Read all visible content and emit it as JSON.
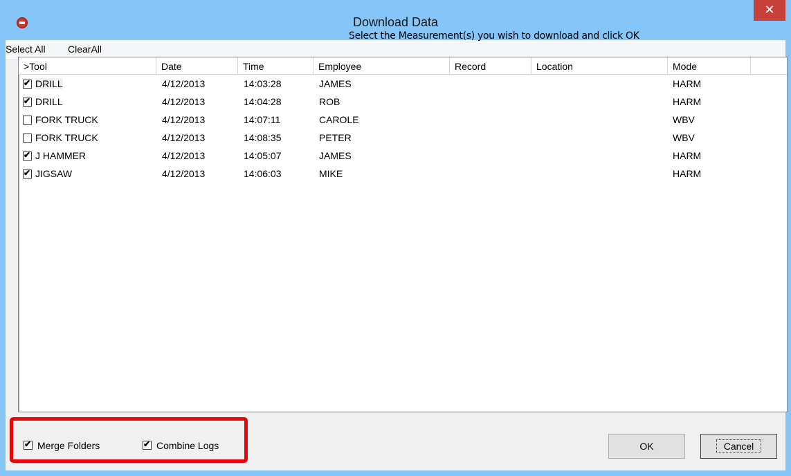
{
  "window": {
    "title": "Download Data",
    "close_glyph": "✕"
  },
  "menu": {
    "select_all": "Select All",
    "clear_all": "ClearAll"
  },
  "instruction": "Select the Measurement(s) you wish to download and click OK",
  "table": {
    "columns": [
      ">Tool",
      "Date",
      "Time",
      "Employee",
      "Record",
      "Location",
      "Mode"
    ],
    "rows": [
      {
        "checked": true,
        "tool": "DRILL",
        "date": "4/12/2013",
        "time": "14:03:28",
        "employee": "JAMES",
        "record": "",
        "location": "",
        "mode": "HARM"
      },
      {
        "checked": true,
        "tool": "DRILL",
        "date": "4/12/2013",
        "time": "14:04:28",
        "employee": "ROB",
        "record": "",
        "location": "",
        "mode": "HARM"
      },
      {
        "checked": false,
        "tool": "FORK TRUCK",
        "date": "4/12/2013",
        "time": "14:07:11",
        "employee": "CAROLE",
        "record": "",
        "location": "",
        "mode": "WBV"
      },
      {
        "checked": false,
        "tool": "FORK TRUCK",
        "date": "4/12/2013",
        "time": "14:08:35",
        "employee": "PETER",
        "record": "",
        "location": "",
        "mode": "WBV"
      },
      {
        "checked": true,
        "tool": "J HAMMER",
        "date": "4/12/2013",
        "time": "14:05:07",
        "employee": "JAMES",
        "record": "",
        "location": "",
        "mode": "HARM"
      },
      {
        "checked": true,
        "tool": "JIGSAW",
        "date": "4/12/2013",
        "time": "14:06:03",
        "employee": "MIKE",
        "record": "",
        "location": "",
        "mode": "HARM"
      }
    ]
  },
  "options": {
    "merge_folders": {
      "label": "Merge Folders",
      "checked": true
    },
    "combine_logs": {
      "label": "Combine Logs",
      "checked": true
    }
  },
  "buttons": {
    "ok": "OK",
    "cancel": "Cancel"
  },
  "colors": {
    "title_bar": "#86c5f8",
    "close_button": "#c7413a",
    "highlight": "#e8060a"
  },
  "icons": {
    "app": "app-icon",
    "close": "close-icon",
    "checkbox": "checkbox-icon"
  }
}
